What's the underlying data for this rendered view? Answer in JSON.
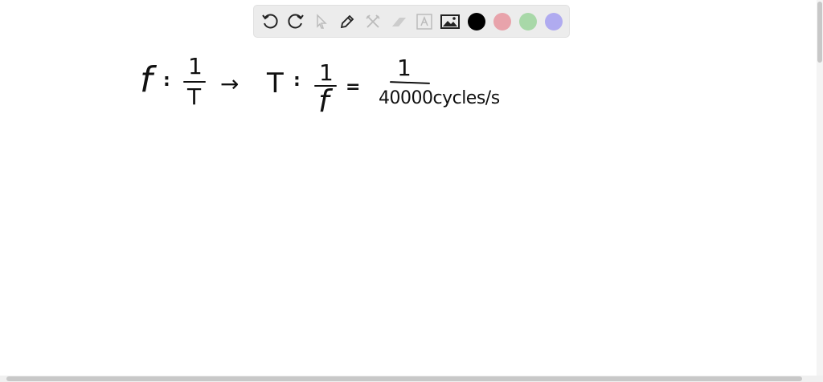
{
  "toolbar": {
    "tools": [
      "undo-icon",
      "redo-icon",
      "select-icon",
      "pen-icon",
      "tools-icon",
      "eraser-icon",
      "text-icon",
      "image-icon"
    ],
    "colors": [
      "#000000",
      "#e8a3ab",
      "#a8d8a8",
      "#b0abf0"
    ]
  },
  "canvas": {
    "eq1_lhs": "f",
    "eq1_sign": ":",
    "eq1_num": "1",
    "eq1_den": "T",
    "arrow": "→",
    "eq2_lhs": "T",
    "eq2_sign": ":",
    "eq2_num": "1",
    "eq2_den": "f",
    "equals": "=",
    "eq3_num": "1",
    "eq3_den": "40000cycles/s"
  }
}
